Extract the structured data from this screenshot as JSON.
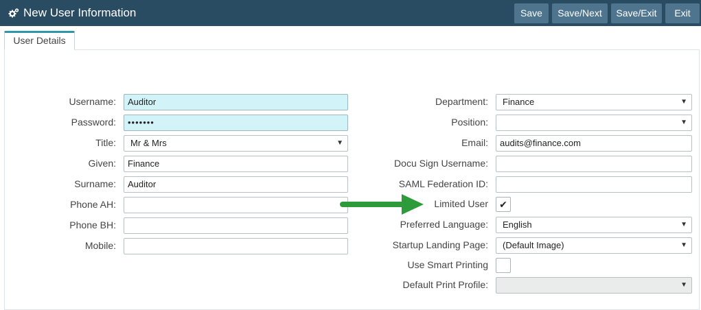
{
  "header": {
    "title": "New User Information",
    "buttons": {
      "save": "Save",
      "save_next": "Save/Next",
      "save_exit": "Save/Exit",
      "exit": "Exit"
    }
  },
  "tabs": [
    {
      "label": "User Details"
    }
  ],
  "left": {
    "username": {
      "label": "Username:",
      "value": "Auditor"
    },
    "password": {
      "label": "Password:",
      "value": "•••••••"
    },
    "title": {
      "label": "Title:",
      "value": "Mr & Mrs"
    },
    "given": {
      "label": "Given:",
      "value": "Finance"
    },
    "surname": {
      "label": "Surname:",
      "value": "Auditor"
    },
    "phone_ah": {
      "label": "Phone AH:",
      "value": ""
    },
    "phone_bh": {
      "label": "Phone BH:",
      "value": ""
    },
    "mobile": {
      "label": "Mobile:",
      "value": ""
    }
  },
  "right": {
    "department": {
      "label": "Department:",
      "value": "Finance"
    },
    "position": {
      "label": "Position:",
      "value": ""
    },
    "email": {
      "label": "Email:",
      "value": "audits@finance.com"
    },
    "docu_sign": {
      "label": "Docu Sign Username:",
      "value": ""
    },
    "saml": {
      "label": "SAML Federation ID:",
      "value": ""
    },
    "limited_user": {
      "label": "Limited User",
      "checked": true,
      "mark": "✔"
    },
    "language": {
      "label": "Preferred Language:",
      "value": "English"
    },
    "landing": {
      "label": "Startup Landing Page:",
      "value": "(Default Image)"
    },
    "smart_printing": {
      "label": "Use Smart Printing",
      "checked": false,
      "mark": ""
    },
    "print_profile": {
      "label": "Default Print Profile:",
      "value": ""
    }
  },
  "caret": "▼",
  "colors": {
    "header": "#2a4c62",
    "button": "#4f758e",
    "highlight_field": "#d2f4f8",
    "arrow": "#2e9b3a"
  }
}
